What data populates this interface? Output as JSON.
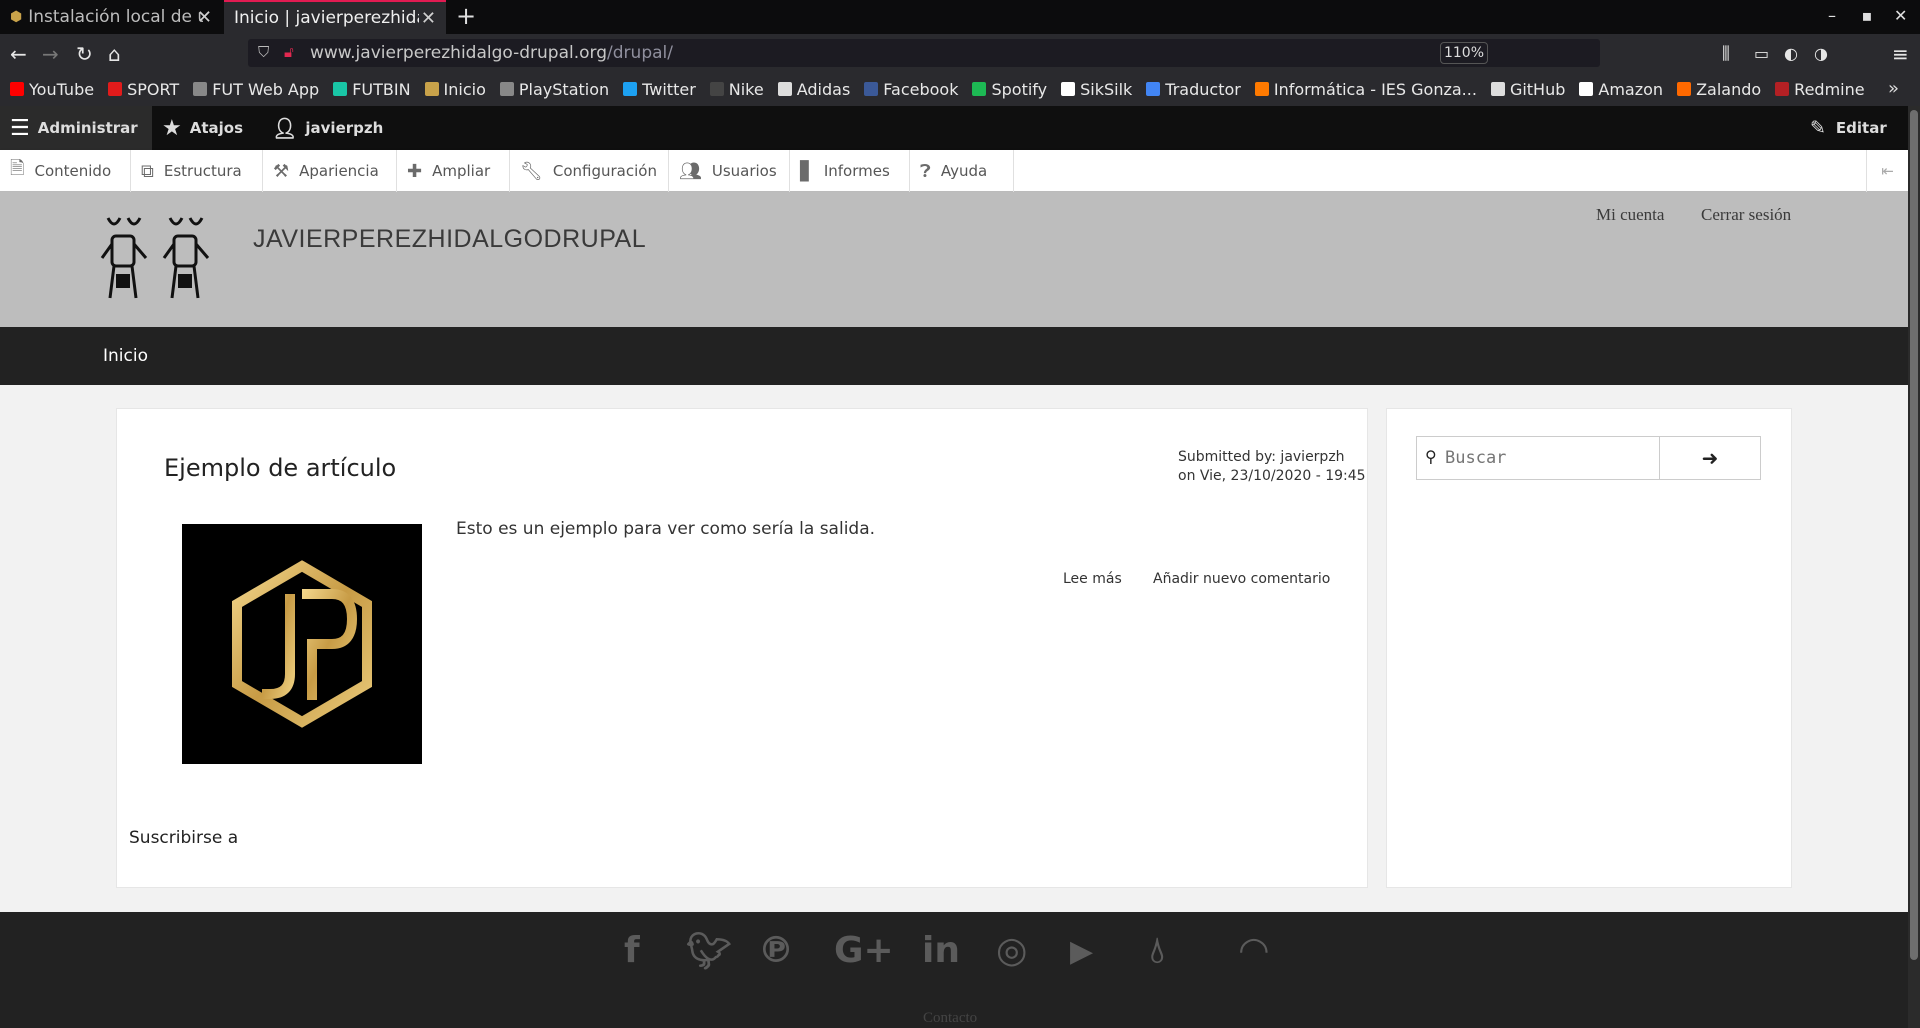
{
  "browser": {
    "tabs": [
      {
        "title": "Instalación local de un",
        "active": false
      },
      {
        "title": "Inicio | javierperezhidalgo",
        "active": true
      }
    ],
    "new_tab": "+",
    "url": {
      "host": "www.javierperezhidalgo-drupal.org",
      "path": "/drupal/"
    },
    "zoom": "110%",
    "bookmarks": [
      {
        "label": "YouTube",
        "color": "#ff0000",
        "icon": "youtube-icon"
      },
      {
        "label": "SPORT",
        "color": "#e21b1b",
        "icon": "sport-icon"
      },
      {
        "label": "FUT Web App",
        "color": "#888888",
        "icon": "globe-icon"
      },
      {
        "label": "FUTBIN",
        "color": "#19c6a6",
        "icon": "futbin-icon"
      },
      {
        "label": "Inicio",
        "color": "#c8a24a",
        "icon": "drupal-icon"
      },
      {
        "label": "PlayStation",
        "color": "#888888",
        "icon": "globe-icon"
      },
      {
        "label": "Twitter",
        "color": "#1da1f2",
        "icon": "twitter-icon"
      },
      {
        "label": "Nike",
        "color": "#444444",
        "icon": "nike-icon"
      },
      {
        "label": "Adidas",
        "color": "#dddddd",
        "icon": "adidas-icon"
      },
      {
        "label": "Facebook",
        "color": "#3b5998",
        "icon": "facebook-icon"
      },
      {
        "label": "Spotify",
        "color": "#1db954",
        "icon": "spotify-icon"
      },
      {
        "label": "SikSilk",
        "color": "#ffffff",
        "icon": "siksilk-icon"
      },
      {
        "label": "Traductor",
        "color": "#4285f4",
        "icon": "translate-icon"
      },
      {
        "label": "Informática - IES Gonza...",
        "color": "#ff7a00",
        "icon": "moodle-icon"
      },
      {
        "label": "GitHub",
        "color": "#dddddd",
        "icon": "github-icon"
      },
      {
        "label": "Amazon",
        "color": "#ffffff",
        "icon": "amazon-icon"
      },
      {
        "label": "Zalando",
        "color": "#ff6900",
        "icon": "zalando-icon"
      },
      {
        "label": "Redmine",
        "color": "#b32024",
        "icon": "redmine-icon"
      }
    ]
  },
  "admin_toolbar": {
    "manage": "Administrar",
    "shortcuts": "Atajos",
    "user": "javierpzh",
    "edit": "Editar",
    "tray": [
      {
        "label": "Contenido",
        "icon": "file-icon"
      },
      {
        "label": "Estructura",
        "icon": "sitemap-icon"
      },
      {
        "label": "Apariencia",
        "icon": "paint-icon"
      },
      {
        "label": "Ampliar",
        "icon": "puzzle-icon"
      },
      {
        "label": "Configuración",
        "icon": "wrench-icon"
      },
      {
        "label": "Usuarios",
        "icon": "users-icon"
      },
      {
        "label": "Informes",
        "icon": "bar-chart-icon"
      },
      {
        "label": "Ayuda",
        "icon": "help-icon"
      }
    ]
  },
  "site": {
    "name": "JAVIERPEREZHIDALGODRUPAL",
    "user_links": {
      "account": "Mi cuenta",
      "logout": "Cerrar sesión"
    },
    "menu": {
      "home": "Inicio"
    }
  },
  "article": {
    "title": "Ejemplo de artículo",
    "submitted_by": "Submitted by: javierpzh",
    "submitted_on": "on Vie, 23/10/2020 - 19:45",
    "body": "Esto es un ejemplo para ver como sería la salida.",
    "read_more": "Lee más",
    "add_comment": "Añadir nuevo comentario"
  },
  "subscribe": "Suscribirse a",
  "search": {
    "placeholder": "Buscar",
    "button_icon": "arrow-right-icon"
  },
  "footer": {
    "social": [
      "facebook-icon",
      "twitter-icon",
      "pinterest-icon",
      "google-plus-icon",
      "linkedin-icon",
      "instagram-icon",
      "youtube-icon",
      "drupal-icon",
      "rss-icon"
    ],
    "contact": "Contacto"
  }
}
